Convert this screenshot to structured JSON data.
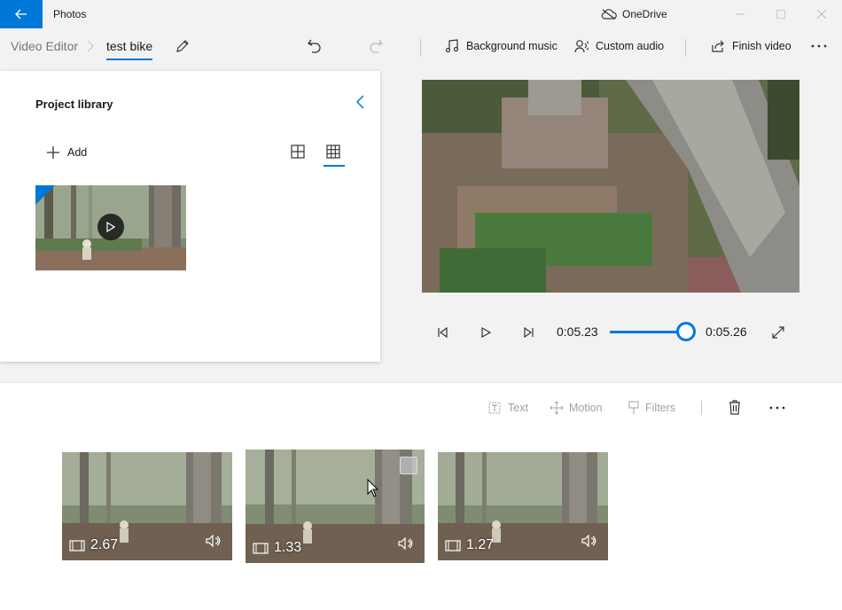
{
  "titlebar": {
    "app_name": "Photos",
    "onedrive_label": "OneDrive",
    "accent": "#0078d7"
  },
  "breadcrumb": {
    "root": "Video Editor",
    "project": "test bike"
  },
  "toolbar": {
    "undo_icon": "undo-icon",
    "redo_icon": "redo-icon",
    "background_music": "Background music",
    "custom_audio": "Custom audio",
    "finish_video": "Finish video",
    "more_icon": "more-icon"
  },
  "library": {
    "title": "Project library",
    "add_label": "Add"
  },
  "player": {
    "current_time": "0:05.23",
    "end_time": "0:05.26"
  },
  "storyboard": {
    "tools": {
      "text": "Text",
      "motion": "Motion",
      "filters": "Filters"
    },
    "clips": [
      {
        "duration": "2.67"
      },
      {
        "duration": "1.33"
      },
      {
        "duration": "1.27"
      }
    ]
  }
}
